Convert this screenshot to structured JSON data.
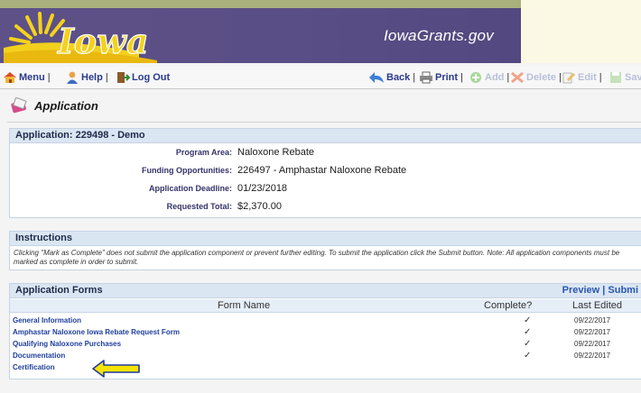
{
  "site": {
    "logo_text": "Iowa",
    "title": "IowaGrants.gov"
  },
  "toolbar": {
    "menu": "Menu",
    "help": "Help",
    "logout": "Log Out",
    "back": "Back",
    "print": "Print",
    "add": "Add",
    "delete": "Delete",
    "edit": "Edit",
    "save": "Sav"
  },
  "page": {
    "title": "Application"
  },
  "application": {
    "header": "Application: 229498 - Demo",
    "fields": [
      {
        "label": "Program Area:",
        "value": "Naloxone Rebate"
      },
      {
        "label": "Funding Opportunities:",
        "value": "226497 - Amphastar Naloxone Rebate"
      },
      {
        "label": "Application Deadline:",
        "value": "01/23/2018"
      },
      {
        "label": "Requested Total:",
        "value": "$2,370.00"
      }
    ]
  },
  "instructions": {
    "header": "Instructions",
    "text": "Clicking \"Mark as Complete\" does not submit the application component or prevent further editing. To submit the application click the Submit button. Note: All application components must be marked as complete in order to submit."
  },
  "forms": {
    "header": "Application Forms",
    "actions": "Preview | Submi",
    "columns": {
      "name": "Form Name",
      "complete": "Complete?",
      "edited": "Last Edited"
    },
    "rows": [
      {
        "name": "General Information",
        "complete": "✓",
        "edited": "09/22/2017"
      },
      {
        "name": "Amphastar Naloxone Iowa Rebate Request Form",
        "complete": "✓",
        "edited": "09/22/2017"
      },
      {
        "name": "Qualifying Naloxone Purchases",
        "complete": "✓",
        "edited": "09/22/2017"
      },
      {
        "name": "Documentation",
        "complete": "✓",
        "edited": "09/22/2017"
      },
      {
        "name": "Certification",
        "complete": "",
        "edited": ""
      }
    ]
  },
  "colors": {
    "banner": "#5a4e86",
    "link": "#1f3f9c",
    "panel_head": "#dbe6f3",
    "arrow": "#f5e400"
  },
  "icons": {
    "menu": "house-icon",
    "help": "person-icon",
    "logout": "door-icon",
    "back": "back-arrow-icon",
    "print": "printer-icon",
    "add": "add-icon",
    "delete": "delete-x-icon",
    "edit": "edit-icon",
    "save": "save-icon",
    "page": "application-icon",
    "pointer": "yellow-arrow-icon"
  }
}
